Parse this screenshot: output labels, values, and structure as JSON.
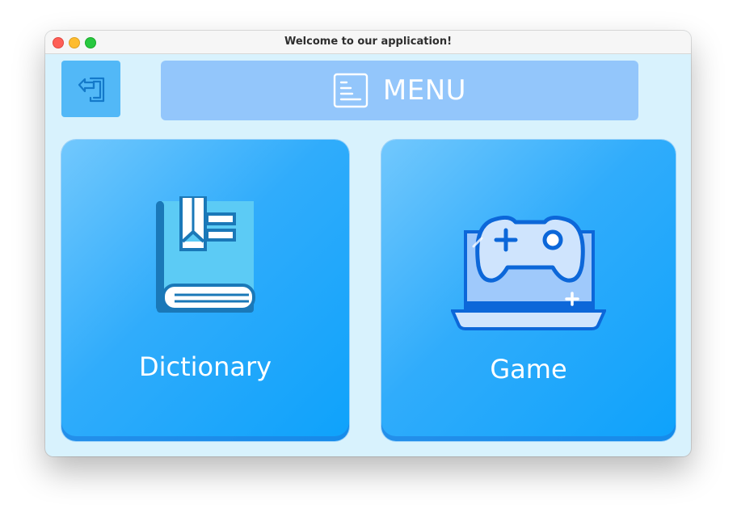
{
  "window": {
    "title": "Welcome to our application!"
  },
  "toolbar": {
    "back_icon": "back-arrow-icon",
    "menu_icon": "document-lines-icon",
    "menu_label": "MENU"
  },
  "tiles": [
    {
      "label": "Dictionary",
      "icon": "book-icon"
    },
    {
      "label": "Game",
      "icon": "gamepad-laptop-icon"
    }
  ],
  "colors": {
    "window_bg": "#d8f2fd",
    "menu_bar": "#93c6fb",
    "back_button": "#52b8f7",
    "tile_gradient_start": "#72c8fd",
    "tile_gradient_end": "#0ea2fb"
  }
}
